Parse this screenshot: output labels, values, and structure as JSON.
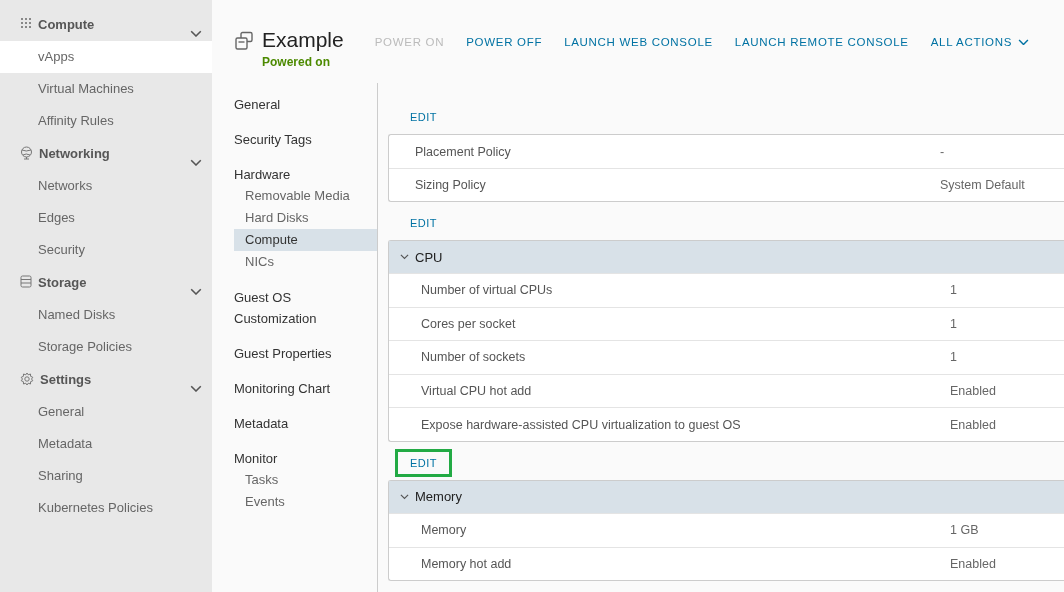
{
  "sidebar": {
    "sections": [
      {
        "title": "Compute",
        "expanded": true,
        "items": [
          {
            "label": "vApps",
            "selected": true
          },
          {
            "label": "Virtual Machines",
            "selected": false
          },
          {
            "label": "Affinity Rules",
            "selected": false
          }
        ]
      },
      {
        "title": "Networking",
        "expanded": true,
        "items": [
          {
            "label": "Networks",
            "selected": false
          },
          {
            "label": "Edges",
            "selected": false
          },
          {
            "label": "Security",
            "selected": false
          }
        ]
      },
      {
        "title": "Storage",
        "expanded": true,
        "items": [
          {
            "label": "Named Disks",
            "selected": false
          },
          {
            "label": "Storage Policies",
            "selected": false
          }
        ]
      },
      {
        "title": "Settings",
        "expanded": true,
        "items": [
          {
            "label": "General",
            "selected": false
          },
          {
            "label": "Metadata",
            "selected": false
          },
          {
            "label": "Sharing",
            "selected": false
          },
          {
            "label": "Kubernetes Policies",
            "selected": false
          }
        ]
      }
    ]
  },
  "header": {
    "title": "Example",
    "status": "Powered on",
    "actions": [
      {
        "label": "POWER ON",
        "disabled": true,
        "dropdown": false
      },
      {
        "label": "POWER OFF",
        "disabled": false,
        "dropdown": false
      },
      {
        "label": "LAUNCH WEB CONSOLE",
        "disabled": false,
        "dropdown": false
      },
      {
        "label": "LAUNCH REMOTE CONSOLE",
        "disabled": false,
        "dropdown": false
      },
      {
        "label": "ALL ACTIONS",
        "disabled": false,
        "dropdown": true
      }
    ]
  },
  "nav": [
    {
      "label": "General",
      "selected": false
    },
    {
      "label": "Security Tags",
      "selected": false
    },
    {
      "label": "Hardware",
      "selected": false,
      "children": [
        {
          "label": "Removable Media",
          "selected": false
        },
        {
          "label": "Hard Disks",
          "selected": false
        },
        {
          "label": "Compute",
          "selected": true
        },
        {
          "label": "NICs",
          "selected": false
        }
      ]
    },
    {
      "label": "Guest OS Customization",
      "selected": false
    },
    {
      "label": "Guest Properties",
      "selected": false
    },
    {
      "label": "Monitoring Chart",
      "selected": false
    },
    {
      "label": "Metadata",
      "selected": false
    },
    {
      "label": "Monitor",
      "selected": false,
      "children": [
        {
          "label": "Tasks",
          "selected": false
        },
        {
          "label": "Events",
          "selected": false
        }
      ]
    }
  ],
  "sections": [
    {
      "edit": {
        "label": "EDIT",
        "highlighted": false
      },
      "rows": [
        {
          "label": "Placement Policy",
          "value": "-"
        },
        {
          "label": "Sizing Policy",
          "value": "System Default"
        }
      ]
    },
    {
      "edit": {
        "label": "EDIT",
        "highlighted": false
      },
      "group": {
        "label": "CPU",
        "expanded": true
      },
      "rows": [
        {
          "label": "Number of virtual CPUs",
          "value": "1"
        },
        {
          "label": "Cores per socket",
          "value": "1"
        },
        {
          "label": "Number of sockets",
          "value": "1"
        },
        {
          "label": "Virtual CPU hot add",
          "value": "Enabled"
        },
        {
          "label": "Expose hardware-assisted CPU virtualization to guest OS",
          "value": "Enabled"
        }
      ]
    },
    {
      "edit": {
        "label": "EDIT",
        "highlighted": true
      },
      "group": {
        "label": "Memory",
        "expanded": true
      },
      "rows": [
        {
          "label": "Memory",
          "value": "1 GB"
        },
        {
          "label": "Memory hot add",
          "value": "Enabled"
        }
      ]
    }
  ]
}
